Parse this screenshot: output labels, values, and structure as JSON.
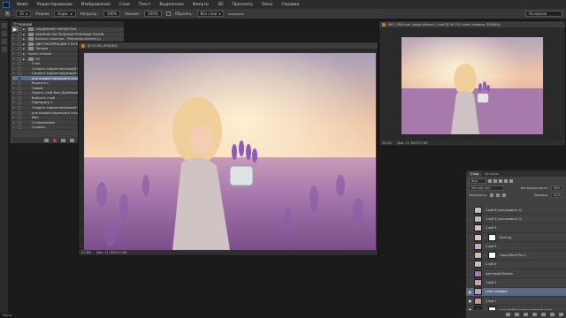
{
  "menubar": {
    "items": [
      "Файл",
      "Редактирование",
      "Изображение",
      "Слои",
      "Текст",
      "Выделение",
      "Фильтр",
      "3D",
      "Просмотр",
      "Окно",
      "Справка"
    ]
  },
  "options": {
    "brush_size": "35",
    "mode_label": "Режим:",
    "mode_value": "Норм.",
    "opacity_label": "Непрозр.:",
    "opacity_value": "100%",
    "flow_label": "Нажим:",
    "flow_value": "100%",
    "sample_label": "Образец:",
    "sample_value": "Все слои",
    "workspace": "Основная"
  },
  "actions_panel": {
    "title": "Операции",
    "rows": [
      {
        "text": "СВАДЕБНАЯ ОБРАБОТКА",
        "type": "set",
        "selected": false
      },
      {
        "text": "ЭКШЕНЫ ПАСТЕЛЬНЫХ РОЗОВЫХ ТОНОВ",
        "type": "set",
        "selected": false
      },
      {
        "text": "Больше экшенов - Photoshop-Actions.ru",
        "type": "set",
        "selected": false
      },
      {
        "text": "ЦВЕТОКОРРЕКЦИЯ +ТОНИРОВАНИЕ",
        "type": "set",
        "selected": false
      },
      {
        "text": "Теплые",
        "type": "set",
        "selected": false
      },
      {
        "text": "Кресс-теплые",
        "type": "action",
        "selected": false
      },
      {
        "text": "ЭО",
        "type": "set",
        "selected": false
      },
      {
        "text": "Стоп",
        "type": "step",
        "selected": false
      },
      {
        "text": "Создать корректирующий слой",
        "type": "step",
        "selected": false
      },
      {
        "text": "Создать корректирующий слой",
        "type": "step",
        "selected": false
      },
      {
        "text": "для корректирующего слоя",
        "type": "step",
        "selected": true
      },
      {
        "text": "Выделить",
        "type": "step",
        "selected": false
      },
      {
        "text": "Новый",
        "type": "step",
        "selected": false
      },
      {
        "text": "Задать слой Фон (Дублировать)",
        "type": "step",
        "selected": false
      },
      {
        "text": "Выбрать слой",
        "type": "step",
        "selected": false
      },
      {
        "text": "Повторить 1",
        "type": "step",
        "selected": false
      },
      {
        "text": "Создать корректирующий слой",
        "type": "step",
        "selected": false
      },
      {
        "text": "для корректирующего слоя",
        "type": "step",
        "selected": false
      },
      {
        "text": "Фон",
        "type": "step",
        "selected": false
      },
      {
        "text": "Сглаживание",
        "type": "step",
        "selected": false
      },
      {
        "text": "Создать",
        "type": "step",
        "selected": false
      }
    ]
  },
  "doc_main": {
    "title": "@ 47,8% (RGB/8#)",
    "zoom": "47,8%",
    "doc_size": "Док: 11,3M/127,4M"
  },
  "doc_second": {
    "title": "IMG_7549 как смарт-объект-1.psd @ 26,2% (слой заливка, RGB/8#)",
    "zoom": "26,2%",
    "doc_size": "Док: 11,3M/127,4M"
  },
  "layers_panel": {
    "tabs": [
      "Слои",
      "История"
    ],
    "kind_label": "Вид",
    "blend_mode": "Мягкий свет",
    "opacity_label": "Непрозрачность:",
    "opacity_value": "80%",
    "lock_label": "Закрепить:",
    "fill_label": "Заливка:",
    "fill_value": "100%",
    "layers": [
      {
        "name": "Слой 8 (копировать 4)",
        "visible": false,
        "selected": false,
        "thumb": "#c0c0c0",
        "mask": false
      },
      {
        "name": "Слой 8 (копировать 3)",
        "visible": false,
        "selected": false,
        "thumb": "#bdbdbd",
        "mask": false
      },
      {
        "name": "Слой 8",
        "visible": false,
        "selected": false,
        "thumb": "#e2b9cc",
        "mask": false
      },
      {
        "name": "Контур",
        "visible": false,
        "selected": false,
        "thumb": "#d4cbb4",
        "mask": true
      },
      {
        "name": "Слой 5",
        "visible": false,
        "selected": false,
        "thumb": "#c9a7c6",
        "mask": false
      },
      {
        "name": "Glow Effect Pro 2",
        "visible": false,
        "selected": false,
        "thumb": "#d6b9b0",
        "mask": true
      },
      {
        "name": "Слой 4",
        "visible": false,
        "selected": false,
        "thumb": "#bfbfbf",
        "mask": false
      },
      {
        "name": "цветовой баланс",
        "visible": false,
        "selected": false,
        "thumb": "#a57ab2",
        "mask": false
      },
      {
        "name": "Слой 2",
        "visible": false,
        "selected": false,
        "thumb": "#c8a4b0",
        "mask": false
      },
      {
        "name": "слой заливка",
        "visible": true,
        "selected": true,
        "thumb": "#b8a0c4",
        "mask": false
      },
      {
        "name": "Слой 1",
        "visible": true,
        "selected": false,
        "thumb": "#c39a8c",
        "mask": false
      },
      {
        "name": "для наибольшего/цветной слой",
        "visible": true,
        "selected": false,
        "thumb": "#3a2e2e",
        "mask": true
      }
    ]
  },
  "status": {
    "text": "Мини"
  }
}
